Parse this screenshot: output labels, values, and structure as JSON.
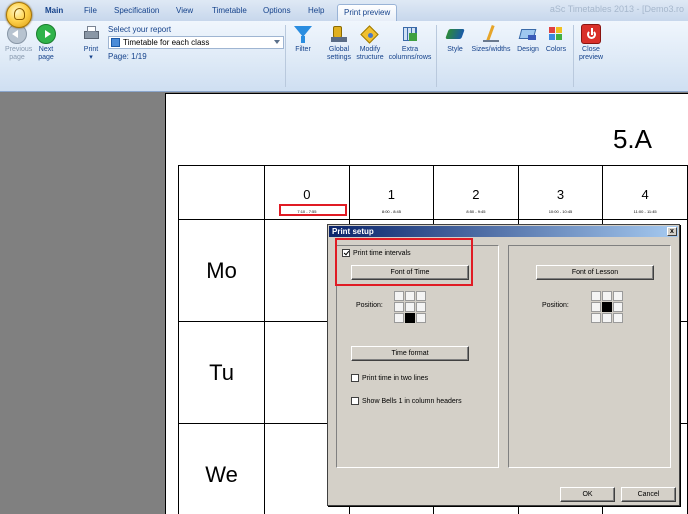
{
  "window": {
    "title": "aSc Timetables 2013  - [Demo3.ro"
  },
  "tabs": [
    "Main",
    "File",
    "Specification",
    "View",
    "Timetable",
    "Options",
    "Help",
    "Print preview"
  ],
  "ribbon": {
    "previous_page": "Previous page",
    "next_page": "Next page",
    "print": "Print",
    "report_label": "Select your report",
    "report_value": "Timetable for each class",
    "page_indicator": "Page: 1/19",
    "filter": "Filter",
    "global_settings": "Global settings",
    "modify_structure": "Modify structure",
    "extra_columns": "Extra columns/rows",
    "style": "Style",
    "sizes_widths": "Sizes/widths",
    "design": "Design",
    "colors": "Colors",
    "close_preview": "Close preview"
  },
  "preview": {
    "class_name": "5.A",
    "periods": [
      {
        "num": "0",
        "time": "7:10 - 7:55"
      },
      {
        "num": "1",
        "time": "8:00 - 8:45"
      },
      {
        "num": "2",
        "time": "8:50 - 9:45"
      },
      {
        "num": "3",
        "time": "10:00 - 10:45"
      },
      {
        "num": "4",
        "time": "11:00 - 11:45"
      }
    ],
    "days": [
      "Mo",
      "Tu",
      "We"
    ]
  },
  "dialog": {
    "title": "Print setup",
    "close_glyph": "x",
    "print_time_intervals": "Print time intervals",
    "font_of_time": "Font of Time",
    "font_of_lesson": "Font of Lesson",
    "position_label": "Position:",
    "time_format": "Time format",
    "print_two_lines": "Print time in two lines",
    "show_bells": "Show Bells 1 in column headers",
    "ok": "OK",
    "cancel": "Cancel"
  },
  "colors": {
    "accent_red": "#e01b24",
    "dialog_face": "#d4d0c8",
    "title_blue": "#0a246a"
  }
}
